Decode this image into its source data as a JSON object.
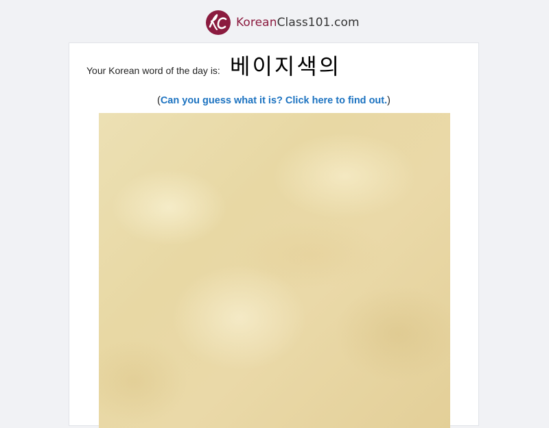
{
  "brand": {
    "name_part1": "Korean",
    "name_part2": "Class101.com",
    "logo_initials": "KC",
    "color_primary": "#8b1b3f"
  },
  "word_of_day": {
    "prefix": "Your Korean word of the day is:",
    "word": "베이지색의"
  },
  "guess": {
    "open_paren": "(",
    "link_text": "Can you guess what it is? Click here to find out.",
    "close_paren": ")",
    "link_color": "#1b72c0"
  },
  "image": {
    "icon": "parchment-texture-image"
  }
}
